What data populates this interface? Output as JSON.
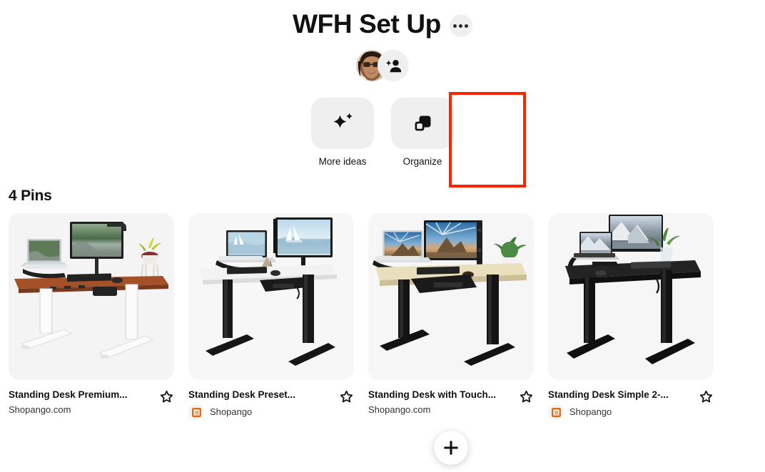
{
  "header": {
    "title": "WFH Set Up",
    "more_options_label": "More options",
    "more_icon": "ellipsis-icon"
  },
  "collaborators": {
    "avatar_alt": "Board owner avatar",
    "add_collaborator_label": "Add collaborator",
    "add_icon": "add-person-icon"
  },
  "actions": [
    {
      "id": "more-ideas",
      "label": "More ideas",
      "icon": "sparkle-icon"
    },
    {
      "id": "organize",
      "label": "Organize",
      "icon": "organize-squares-icon"
    }
  ],
  "annotation": {
    "target": "organize",
    "color": "#FF2400"
  },
  "pins_section": {
    "heading": "4 Pins",
    "count": 4
  },
  "pins": [
    {
      "title": "Standing Desk Premium...",
      "source_text": "Shopango.com",
      "source_type": "plain",
      "brand_icon": "",
      "save_icon": "star-outline-icon",
      "image_alt": "Standing desk with cherry wood top and white legs, laptop and monitor",
      "desk_top_color": "#a4512a",
      "desk_leg_color": "#f2f2f2",
      "monitor_scene": "forest-river"
    },
    {
      "title": "Standing Desk Preset...",
      "source_text": "Shopango",
      "source_type": "branded",
      "brand_icon": "shopango-logo-icon",
      "save_icon": "star-outline-icon",
      "image_alt": "Standing desk with white top and black legs, laptop and monitor",
      "desk_top_color": "#f0f0f0",
      "desk_leg_color": "#1c1c1c",
      "monitor_scene": "sailboat-lake"
    },
    {
      "title": "Standing Desk with Touch...",
      "source_text": "Shopango.com",
      "source_type": "plain",
      "brand_icon": "",
      "save_icon": "star-outline-icon",
      "image_alt": "Standing desk with maple top and black legs, laptop, monitor and plant",
      "desk_top_color": "#e8dcb8",
      "desk_leg_color": "#1c1c1c",
      "monitor_scene": "desert-sunburst"
    },
    {
      "title": "Standing Desk Simple 2-...",
      "source_text": "Shopango",
      "source_type": "branded",
      "brand_icon": "shopango-logo-icon",
      "save_icon": "star-outline-icon",
      "image_alt": "Standing desk with black top and black legs, laptop and monitor",
      "desk_top_color": "#1e1e1e",
      "desk_leg_color": "#181818",
      "monitor_scene": "snow-mountains"
    }
  ],
  "fab": {
    "label": "Create",
    "icon": "plus-icon"
  },
  "colors": {
    "accent_red": "#FF2400",
    "brand_orange": "#E8670C",
    "tile_gray": "#efefef",
    "image_bg": "#f4f4f4",
    "text_primary": "#111111",
    "text_secondary": "#333333"
  }
}
